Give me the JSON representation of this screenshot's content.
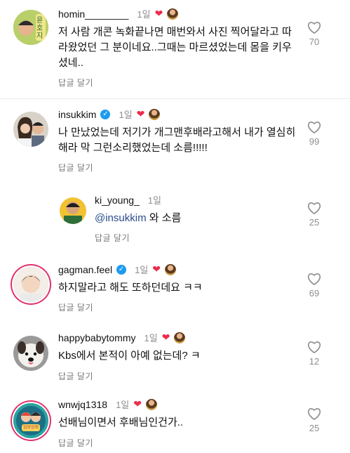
{
  "comments": [
    {
      "username": "homin________",
      "age": "1일",
      "verified": false,
      "author_liked": true,
      "text": "저 사람 개콘 녹화끝나면 매번와서 사진 찍어달라고 따라왔었던 그 분이네요..그때는 마르셨었는데 몸을 키우셨네..",
      "reply_label": "답글 달기",
      "likes": "70",
      "avatar_label": "윤호지"
    },
    {
      "username": "insukkim",
      "age": "1일",
      "verified": true,
      "author_liked": true,
      "text": "나 만났었는데 저기가 개그맨후배라고해서 내가 열심히해라 막 그런소리했었는데 소름!!!!!",
      "reply_label": "답글 달기",
      "likes": "99"
    },
    {
      "username": "ki_young_",
      "age": "1일",
      "mention": "@insukkim",
      "text": " 와 소름",
      "reply_label": "답글 달기",
      "likes": "25"
    },
    {
      "username": "gagman.feel",
      "age": "1일",
      "verified": true,
      "author_liked": true,
      "text": "하지말라고 해도 또하던데요 ㅋㅋ",
      "reply_label": "답글 달기",
      "likes": "69"
    },
    {
      "username": "happybabytommy",
      "age": "1일",
      "author_liked": true,
      "text": "Kbs에서 본적이 아예 없는데? ㅋ",
      "reply_label": "답글 달기",
      "likes": "12"
    },
    {
      "username": "wnwjq1318",
      "age": "1일",
      "author_liked": true,
      "text": "선배님이면서 후배님인건가..",
      "reply_label": "답글 달기",
      "likes": "25",
      "avatar_label": "업보상회"
    }
  ],
  "colors": {
    "heart": "#ed2b4c",
    "verified": "#1d9bf0",
    "mention": "#2b4c8c",
    "muted": "#8e8e8e",
    "story_ring": "#e1306c"
  },
  "icons": {
    "like": "heart-outline-icon",
    "author_like": "heart-filled-icon",
    "verified": "verified-badge-icon"
  }
}
